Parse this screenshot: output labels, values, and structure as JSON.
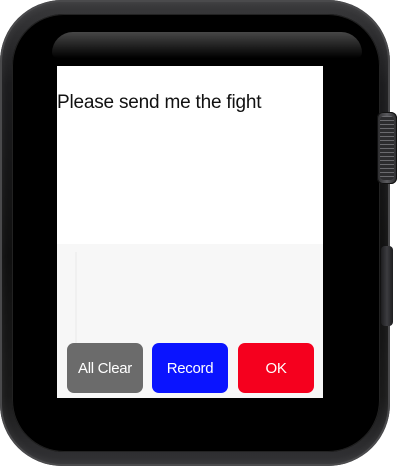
{
  "screen": {
    "message": "Please send me the fight"
  },
  "buttons": {
    "all_clear": {
      "label": "All Clear",
      "color": "#6b6b6b"
    },
    "record": {
      "label": "Record",
      "color": "#0a14ff"
    },
    "ok": {
      "label": "OK",
      "color": "#f5001e"
    }
  },
  "device": {
    "case_color": "#1a1a1a",
    "screen_color": "#ffffff"
  }
}
